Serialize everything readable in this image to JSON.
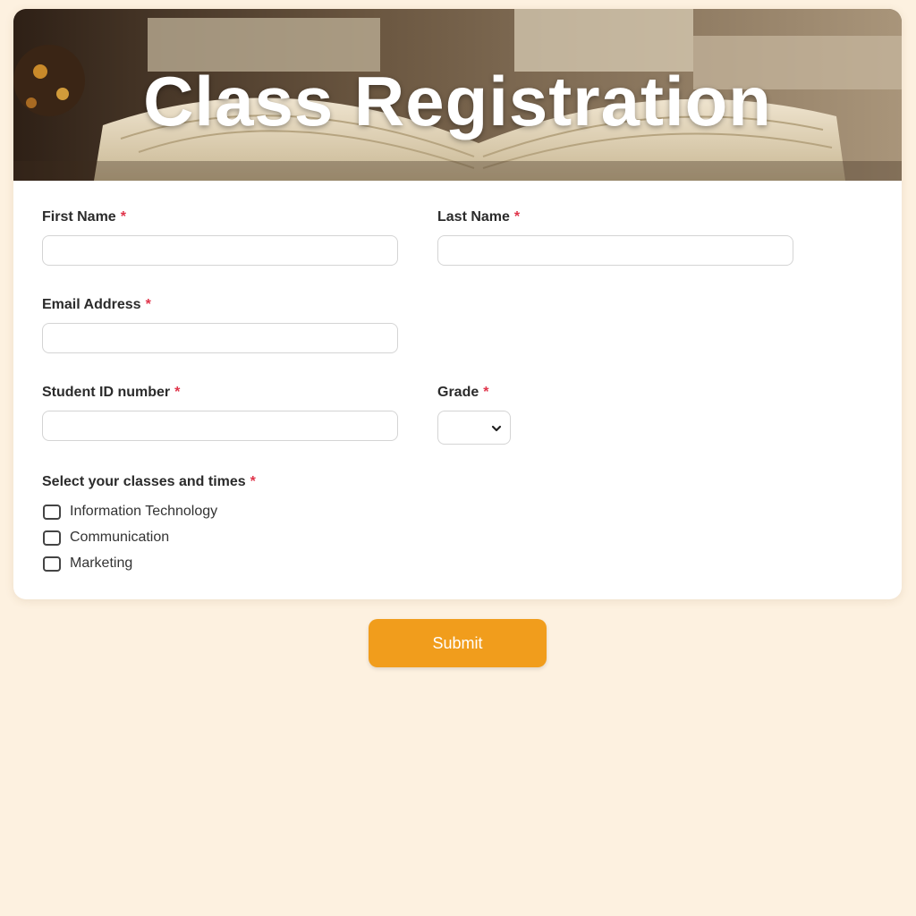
{
  "header": {
    "title": "Class Registration"
  },
  "form": {
    "first_name": {
      "label": "First Name",
      "required_mark": "*",
      "value": ""
    },
    "last_name": {
      "label": "Last Name",
      "required_mark": "*",
      "value": ""
    },
    "email": {
      "label": "Email Address",
      "required_mark": "*",
      "value": ""
    },
    "student_id": {
      "label": "Student ID number",
      "required_mark": "*",
      "value": ""
    },
    "grade": {
      "label": "Grade",
      "required_mark": "*",
      "selected": ""
    },
    "classes": {
      "label": "Select your classes and times",
      "required_mark": "*",
      "options": [
        {
          "label": "Information Technology",
          "checked": false
        },
        {
          "label": "Communication",
          "checked": false
        },
        {
          "label": "Marketing",
          "checked": false
        }
      ]
    },
    "submit_label": "Submit"
  },
  "colors": {
    "page_background": "#fdf1e0",
    "card_background": "#ffffff",
    "accent": "#f19d1c",
    "required": "#e0344a"
  },
  "icons": {
    "header_image": "open-book-photo",
    "grade_dropdown": "chevron-down-icon"
  }
}
